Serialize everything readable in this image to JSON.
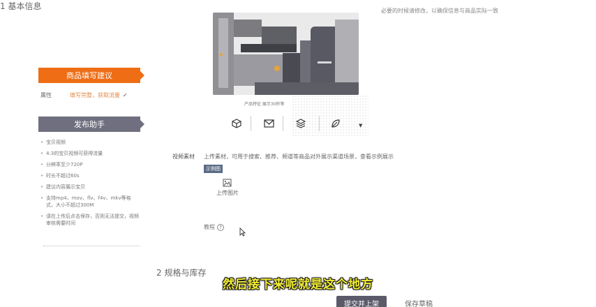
{
  "sections": {
    "basic_info": "1 基本信息",
    "spec_stock": "2 规格与库存"
  },
  "top_note": "必要的时候请修改，以确保信息与商品实际一致",
  "image": {
    "caption": "产品特征 展示30秒等"
  },
  "icon_toolbar": [
    "box-icon",
    "mail-icon",
    "layers-icon",
    "leaf-icon"
  ],
  "sidebar": {
    "suggest_title": "商品填写建议",
    "tip_label": "属性",
    "tip_warning": "填写完整，获取流量",
    "tip_check": "✓",
    "helper_title": "发布助手",
    "helper_items": [
      "宝贝视频",
      "4:3的宝贝视频可获得流量",
      "分辨率至少720P",
      "时长不超过60s",
      "建议内容展示宝贝",
      "支持mp4、mov、flv、f4v、mkv等格式，大小不超过300M",
      "请在上传后点击保存，否则无法提交，视频审核需要时间"
    ]
  },
  "form": {
    "field_label": "视频素材",
    "field_desc": "上传素材，可用于搜索、推荐、频道等商品对外展示渠道场景，查看示例展示",
    "sample_tag": "示例图",
    "upload_label": "上传图片",
    "tutorial_label": "教程",
    "tutorial_icon": "?"
  },
  "subtitle": "然后接下来呢就是这个地方",
  "footer": {
    "submit_label": "提交并上架",
    "draft_label": "保存草稿"
  }
}
